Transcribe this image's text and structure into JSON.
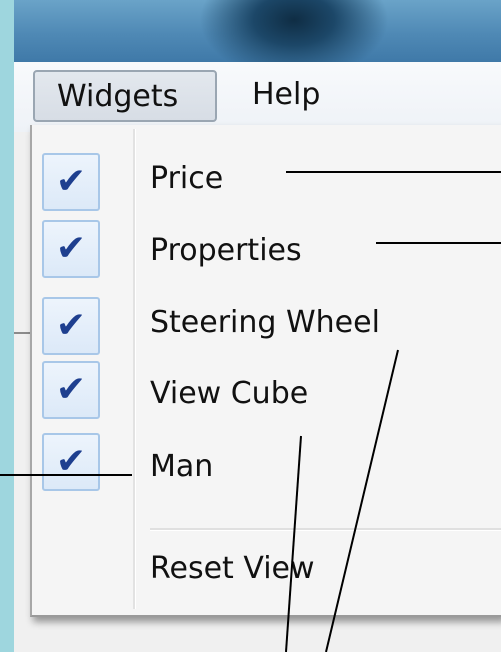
{
  "menubar": {
    "widgets_label": "Widgets",
    "help_label": "Help"
  },
  "dropdown": {
    "items": [
      {
        "label": "Price",
        "checked": true,
        "check_glyph": "✔"
      },
      {
        "label": "Properties",
        "checked": true,
        "check_glyph": "✔"
      },
      {
        "label": "Steering Wheel",
        "checked": true,
        "check_glyph": "✔"
      },
      {
        "label": "View Cube",
        "checked": true,
        "check_glyph": "✔"
      },
      {
        "label": "Man",
        "checked": true,
        "check_glyph": "✔"
      }
    ],
    "reset_label": "Reset View"
  }
}
